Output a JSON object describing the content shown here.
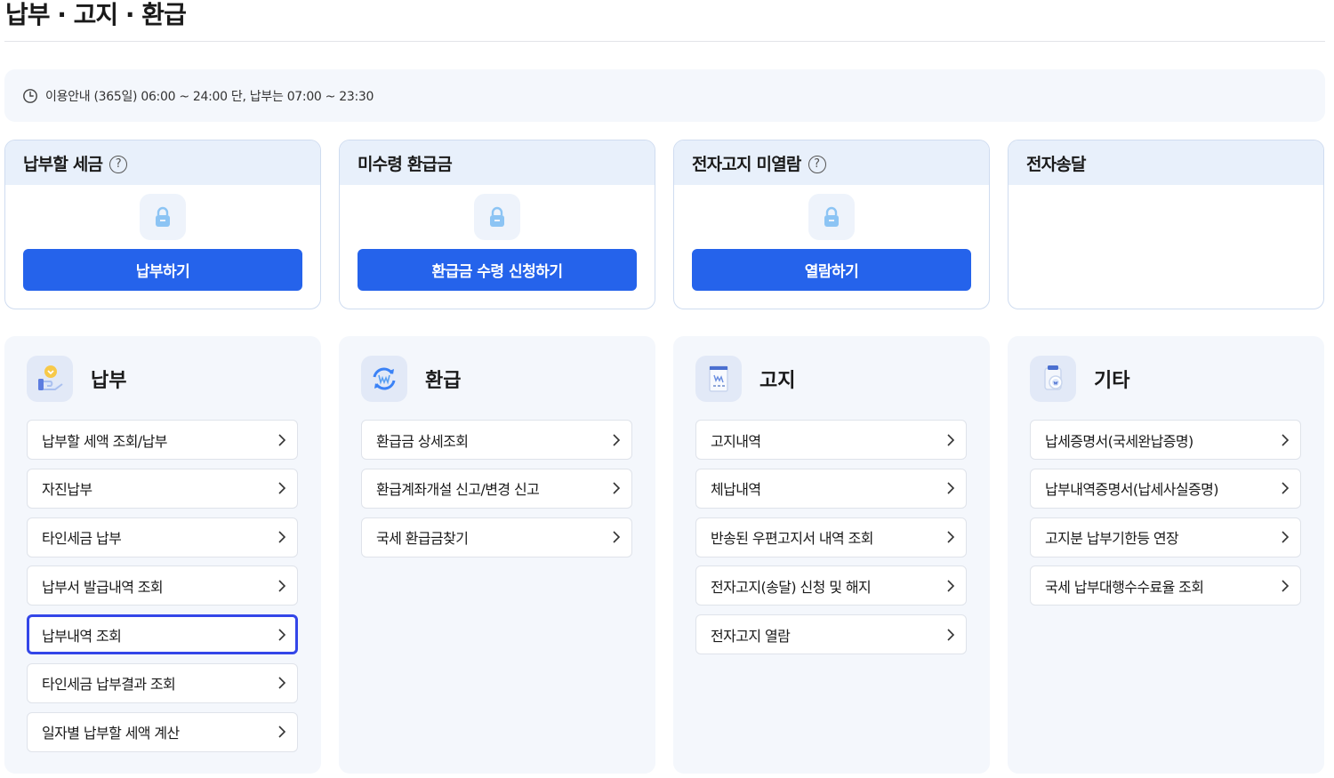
{
  "page": {
    "title": "납부 · 고지 · 환급"
  },
  "notice": {
    "text": "이용안내 (365일) 06:00 ~ 24:00 단, 납부는 07:00 ~ 23:30"
  },
  "summary": [
    {
      "label": "납부할 세금",
      "help": true,
      "button": "납부하기"
    },
    {
      "label": "미수령 환급금",
      "help": false,
      "button": "환급금 수령 신청하기"
    },
    {
      "label": "전자고지 미열람",
      "help": true,
      "button": "열람하기"
    },
    {
      "label": "전자송달",
      "help": false,
      "button": ""
    }
  ],
  "help_mark": "?",
  "menus": [
    {
      "title": "납부",
      "icon": "payment-hand-icon",
      "items": [
        "납부할 세액 조회/납부",
        "자진납부",
        "타인세금 납부",
        "납부서 발급내역 조회",
        "납부내역 조회",
        "타인세금 납부결과 조회",
        "일자별 납부할 세액 계산"
      ]
    },
    {
      "title": "환급",
      "icon": "refund-cycle-icon",
      "items": [
        "환급금 상세조회",
        "환급계좌개설 신고/변경 신고",
        "국세 환급금찾기"
      ]
    },
    {
      "title": "고지",
      "icon": "bill-document-icon",
      "items": [
        "고지내역",
        "체납내역",
        "반송된 우편고지서 내역 조회",
        "전자고지(송달) 신청 및 해지",
        "전자고지 열람"
      ]
    },
    {
      "title": "기타",
      "icon": "coin-jar-icon",
      "items": [
        "납세증명서(국세완납증명)",
        "납부내역증명서(납세사실증명)",
        "고지분 납부기한등 연장",
        "국세 납부대행수수료율 조회"
      ]
    }
  ],
  "active_item": "납부내역 조회",
  "colors": {
    "primary": "#2563eb",
    "active_border": "#3346e8",
    "card_bg": "#f4f7fc",
    "head_bg": "#e8f0fb"
  }
}
